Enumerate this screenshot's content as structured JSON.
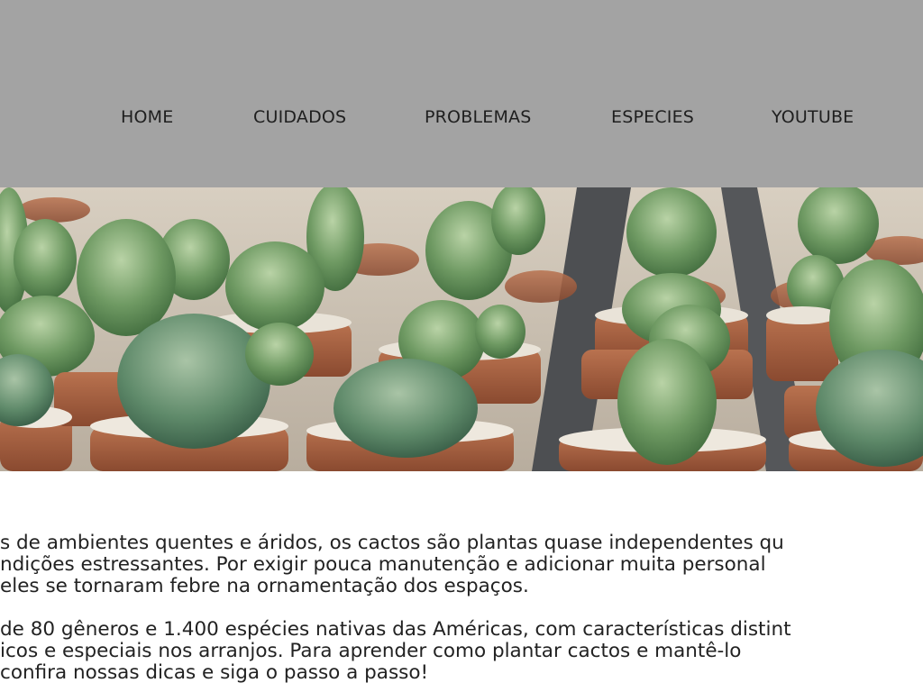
{
  "nav": {
    "home": "HOME",
    "cuidados": "CUIDADOS",
    "problemas": "PROBLEMAS",
    "especies": "ESPECIES",
    "youtube": "YOUTUBE"
  },
  "paragraphs": [
    {
      "lines": [
        "s de ambientes quentes e áridos, os cactos são plantas quase independentes qu",
        "ndições estressantes. Por exigir pouca manutenção e adicionar muita personal",
        "eles se tornaram febre na ornamentação dos espaços."
      ]
    },
    {
      "lines": [
        "de 80 gêneros e 1.400 espécies nativas das Américas, com características distint",
        "icos e especiais nos arranjos. Para aprender como plantar cactos e mantê-lo",
        "confira nossas dicas e siga o passo a passo!"
      ]
    }
  ],
  "colors": {
    "header_bg": "#a3a3a3",
    "nav_text": "#1f1f1f",
    "body_text": "#222222"
  }
}
